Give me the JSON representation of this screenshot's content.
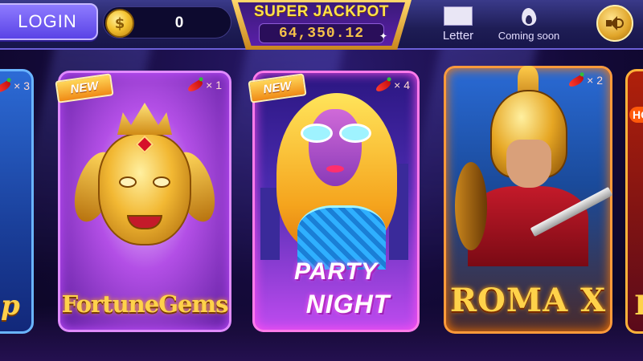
{
  "topbar": {
    "login_label": "LOGIN",
    "coin_symbol": "$",
    "coin_balance": "0",
    "jackpot_title": "SUPER JACKPOT",
    "jackpot_value": "64,350.12",
    "letter_label": "Letter",
    "coming_soon_label": "Coming soon",
    "sound_icon": "speaker-icon",
    "letter_icon": "envelope-icon",
    "coming_soon_icon": "flame-icon"
  },
  "games": [
    {
      "title": "p",
      "chili_count": "× 3",
      "is_new": false
    },
    {
      "title": "FortuneGems",
      "chili_count": "× 1",
      "is_new": true,
      "badge": "NEW"
    },
    {
      "title_line1": "PARTY",
      "title_line2": "NIGHT",
      "chili_count": "× 4",
      "is_new": true,
      "badge": "NEW"
    },
    {
      "title": "ROMA X",
      "chili_count": "× 2",
      "is_new": false
    },
    {
      "title": "R",
      "badge": "HO"
    }
  ],
  "colors": {
    "accent_gold": "#ffd24a",
    "login_purple": "#6f58f0",
    "background": "#140a3a"
  }
}
